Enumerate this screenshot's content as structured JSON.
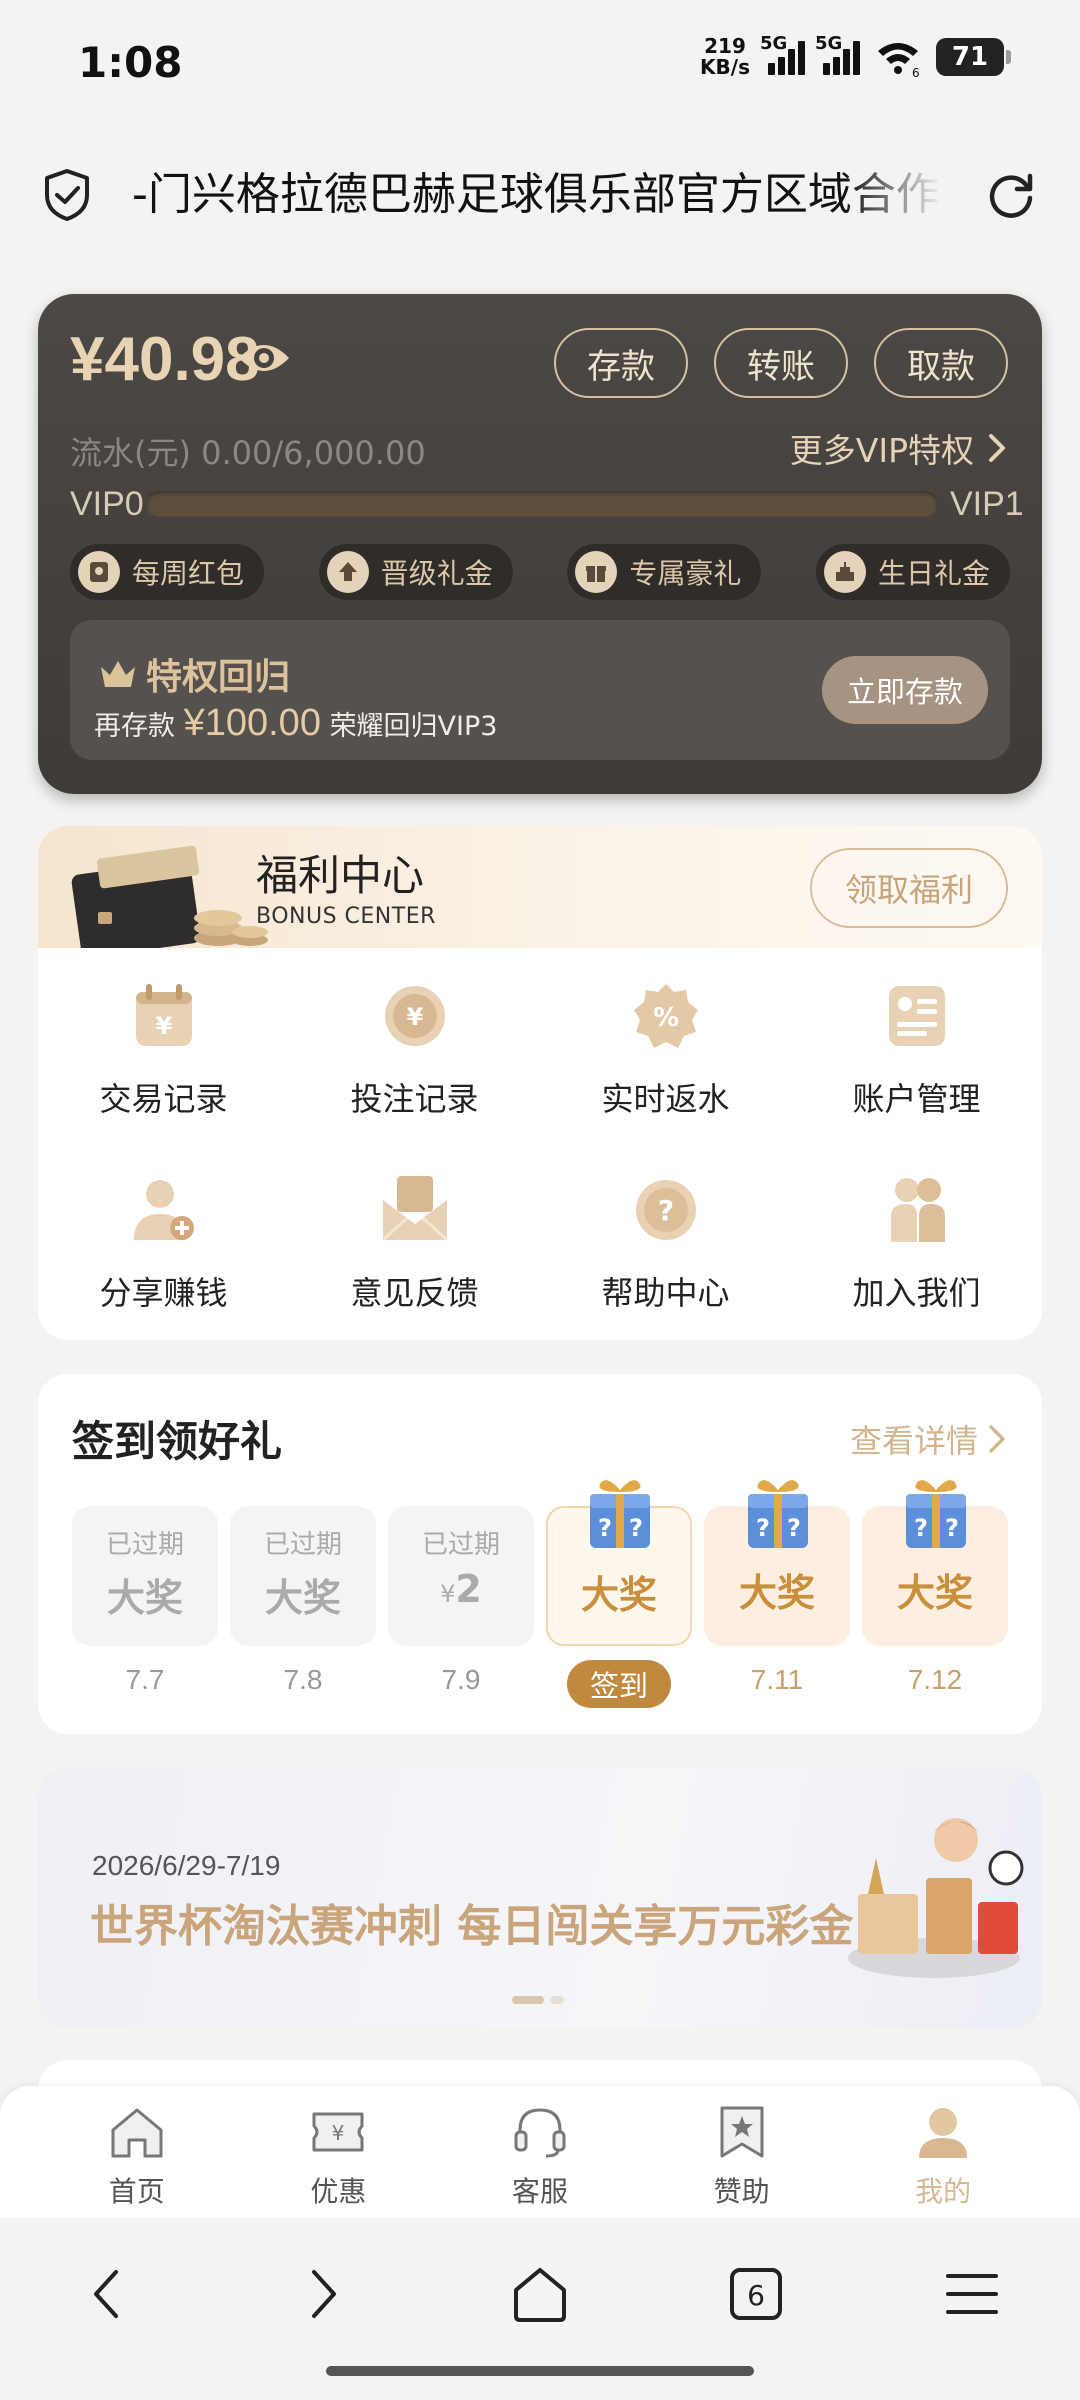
{
  "status_bar": {
    "time": "1:08",
    "net_speed_value": "219",
    "net_speed_unit": "KB/s",
    "sim1_label": "5G",
    "sim2_label": "5G",
    "wifi_label": "6",
    "battery": "71"
  },
  "browser": {
    "url_text": "-门兴格拉德巴赫足球俱乐部官方区域合作伙伴",
    "tabs_count": "6"
  },
  "wallet": {
    "balance": "¥40.98",
    "deposit_label": "存款",
    "transfer_label": "转账",
    "withdraw_label": "取款",
    "turnover": "流水(元) 0.00/6,000.00",
    "more_vip": "更多VIP特权",
    "vip_current": "VIP0",
    "vip_next": "VIP1",
    "vip_progress": 0,
    "perks": [
      {
        "label": "每周红包",
        "icon": "red-envelope-icon"
      },
      {
        "label": "晋级礼金",
        "icon": "upgrade-icon"
      },
      {
        "label": "专属豪礼",
        "icon": "gift-icon"
      },
      {
        "label": "生日礼金",
        "icon": "cake-icon"
      }
    ],
    "privilege": {
      "title": "特权回归",
      "prefix": "再存款",
      "amount": "¥100.00",
      "suffix": "荣耀回归VIP3",
      "button": "立即存款"
    }
  },
  "bonus_center": {
    "title": "福利中心",
    "subtitle": "BONUS CENTER",
    "claim_button": "领取福利",
    "items": [
      {
        "label": "交易记录",
        "icon": "transaction-record-icon"
      },
      {
        "label": "投注记录",
        "icon": "bet-record-icon"
      },
      {
        "label": "实时返水",
        "icon": "rebate-icon"
      },
      {
        "label": "账户管理",
        "icon": "account-card-icon"
      },
      {
        "label": "分享赚钱",
        "icon": "share-user-icon"
      },
      {
        "label": "意见反馈",
        "icon": "feedback-envelope-icon"
      },
      {
        "label": "帮助中心",
        "icon": "help-icon"
      },
      {
        "label": "加入我们",
        "icon": "join-us-icon"
      }
    ]
  },
  "signin": {
    "title": "签到领好礼",
    "details": "查看详情",
    "sign_button": "签到",
    "days": [
      {
        "status": "已过期",
        "prize": "大奖",
        "date": "7.7"
      },
      {
        "status": "已过期",
        "prize": "大奖",
        "date": "7.8"
      },
      {
        "status": "已过期",
        "currency": "¥",
        "prize": "2",
        "date": "7.9"
      },
      {
        "prize": "大奖"
      },
      {
        "prize": "大奖",
        "date": "7.11"
      },
      {
        "prize": "大奖",
        "date": "7.12"
      }
    ]
  },
  "banner": {
    "date": "2026/6/29-7/19",
    "title": "世界杯淘汰赛冲刺 每日闯关享万元彩金"
  },
  "tabbar": {
    "items": [
      {
        "label": "首页",
        "icon": "home-icon"
      },
      {
        "label": "优惠",
        "icon": "coupon-icon"
      },
      {
        "label": "客服",
        "icon": "headset-icon"
      },
      {
        "label": "赞助",
        "icon": "sponsor-icon"
      },
      {
        "label": "我的",
        "icon": "profile-icon"
      }
    ],
    "active": "我的"
  },
  "colors": {
    "accent_gold": "#c9a06a",
    "wallet_bg": "#464341",
    "sign_button": "#c08a3e",
    "claim_border": "#d7bd98"
  }
}
